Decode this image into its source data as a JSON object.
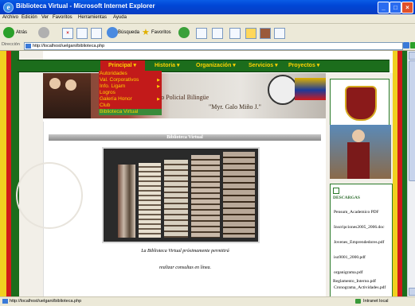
{
  "window": {
    "title": "Biblioteca Virtual - Microsoft Internet Explorer"
  },
  "menu": [
    "Archivo",
    "Edición",
    "Ver",
    "Favoritos",
    "Herramientas",
    "Ayuda"
  ],
  "toolbar": {
    "back_label": "Atrás",
    "search_label": "Búsqueda",
    "favorites_label": "Favoritos"
  },
  "address": {
    "label": "Dirección",
    "url": "http://localhost/uelgani/biblioteca.php"
  },
  "status": {
    "text": "http://localhost/uelgani/biblioteca.php",
    "zone": "Intranet local"
  },
  "nav": [
    {
      "label": "Principal ▾"
    },
    {
      "label": "Historia ▾"
    },
    {
      "label": "Organización ▾"
    },
    {
      "label": "Servicios ▾"
    },
    {
      "label": "Proyectos ▾"
    }
  ],
  "dropdown": [
    "Autoridades",
    "Val. Corporativos",
    "Info. Ligam",
    "Logros",
    "Galería Honor",
    "Club",
    "Biblioteca Virtual"
  ],
  "banner": {
    "school": "Liceo Policial Bilingüe",
    "name": "\"Myr. Galo Miño J.\""
  },
  "section_title": "Biblioteca Virtual",
  "caption": {
    "line1": "La Biblioteca Virtual próximamente permitirá",
    "line2": "realizar consultas en línea."
  },
  "downloads": {
    "title": "DESCARGAS",
    "items": [
      "Pensum_Academico PDF",
      "Inscripciones2005_2006.doc",
      "Jovenes_Emprendedores.pdf",
      "iso9001_2000.pdf",
      "organigrama.pdf",
      "Cronograma_Actividades.pdf",
      "Reglamento_Interno.pdf"
    ]
  },
  "colors": {
    "green": "#1c6d1c",
    "yellow": "#ffd200",
    "red": "#c21a1a",
    "xp_blue": "#0a5ce6"
  }
}
